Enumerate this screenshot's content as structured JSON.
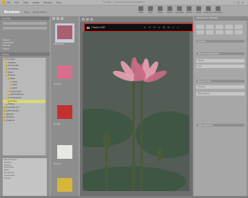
{
  "window": {
    "title": "ViewNX-i - [C:\\Users\\user\\Pictures\\Nikon]"
  },
  "menu": [
    "File",
    "Edit",
    "View",
    "Image",
    "Window",
    "Help"
  ],
  "toolbar": {
    "active_mode": "Browser",
    "modes": [
      "Map",
      "Movie Editor"
    ],
    "actions": [
      {
        "label": "Adjust",
        "icon": "adjust-icon"
      },
      {
        "label": "Print",
        "icon": "print-icon"
      },
      {
        "label": "Email",
        "icon": "email-icon"
      },
      {
        "label": "Upload",
        "icon": "upload-icon"
      },
      {
        "label": "Open With",
        "icon": "open-with-icon"
      },
      {
        "label": "Camera",
        "icon": "camera-icon"
      },
      {
        "label": "Export",
        "icon": "export-icon"
      },
      {
        "label": "Slide show",
        "icon": "slideshow-icon"
      },
      {
        "label": "NX Studio",
        "icon": "studio-icon"
      }
    ]
  },
  "left": {
    "header": "Favorites",
    "collections": [
      "Albums",
      "Collections",
      "Pictures",
      "Videos"
    ],
    "folders_header": "Folders",
    "tree": [
      {
        "label": "Computer",
        "indent": 0
      },
      {
        "label": "Desktop",
        "indent": 1
      },
      {
        "label": "Documents",
        "indent": 1
      },
      {
        "label": "Downloads",
        "indent": 1
      },
      {
        "label": "Music",
        "indent": 1
      },
      {
        "label": "Pictures",
        "indent": 1
      },
      {
        "label": "Nikon",
        "indent": 2
      },
      {
        "label": "2016",
        "indent": 3
      },
      {
        "label": "2017",
        "indent": 3
      },
      {
        "label": "2018",
        "indent": 3
      },
      {
        "label": "Camera Roll",
        "indent": 2
      },
      {
        "label": "Saved Pictures",
        "indent": 2
      },
      {
        "label": "Screenshots",
        "indent": 2
      },
      {
        "label": "Flowers",
        "indent": 2,
        "highlight": true
      },
      {
        "label": "Videos",
        "indent": 1
      },
      {
        "label": "Local Disk (C:)",
        "indent": 0
      },
      {
        "label": "DVD Drive (D:)",
        "indent": 0
      },
      {
        "label": "Network",
        "indent": 0
      },
      {
        "label": "Libraries",
        "indent": 0
      },
      {
        "label": "OneDrive",
        "indent": 0
      }
    ],
    "notes": [
      "Recent Folders",
      "Desktop",
      "Pictures",
      "Downloads",
      "Nikon",
      "Documents",
      "Screenshots",
      "Flowers"
    ]
  },
  "strip": {
    "thumbs": [
      {
        "label": "Waterlily.NEF",
        "color": "#a8606f"
      },
      {
        "label": "Lotus.JPG",
        "color": "#d6708a"
      },
      {
        "label": "Rose.JPG",
        "color": "#c23030"
      },
      {
        "label": "Daisy.JPG",
        "color": "#e8e8e0"
      },
      {
        "label": "Tulip.JPG",
        "color": "#d6b63a"
      }
    ]
  },
  "viewer": {
    "filename": "Flowers.NEF",
    "tools": [
      "←",
      "↑",
      "→",
      "↓",
      "↻",
      "↺",
      "✓",
      "✓"
    ],
    "photo_colors": {
      "petal": "#c96b86",
      "petal_light": "#e4a0b2",
      "stem": "#4a5a3a",
      "leaf": "#3f5645",
      "bg": "#535d55"
    }
  },
  "right": {
    "header": "Adjustments / Metadata",
    "sections": [
      "Quick Fix",
      "Exposure Compensation",
      "Picture Control",
      "Light Adjustment"
    ],
    "fields": [
      "Camera",
      "Lens",
      "Exposure",
      "White Balance"
    ]
  },
  "colors": {
    "highlight_border": "#e01818"
  }
}
